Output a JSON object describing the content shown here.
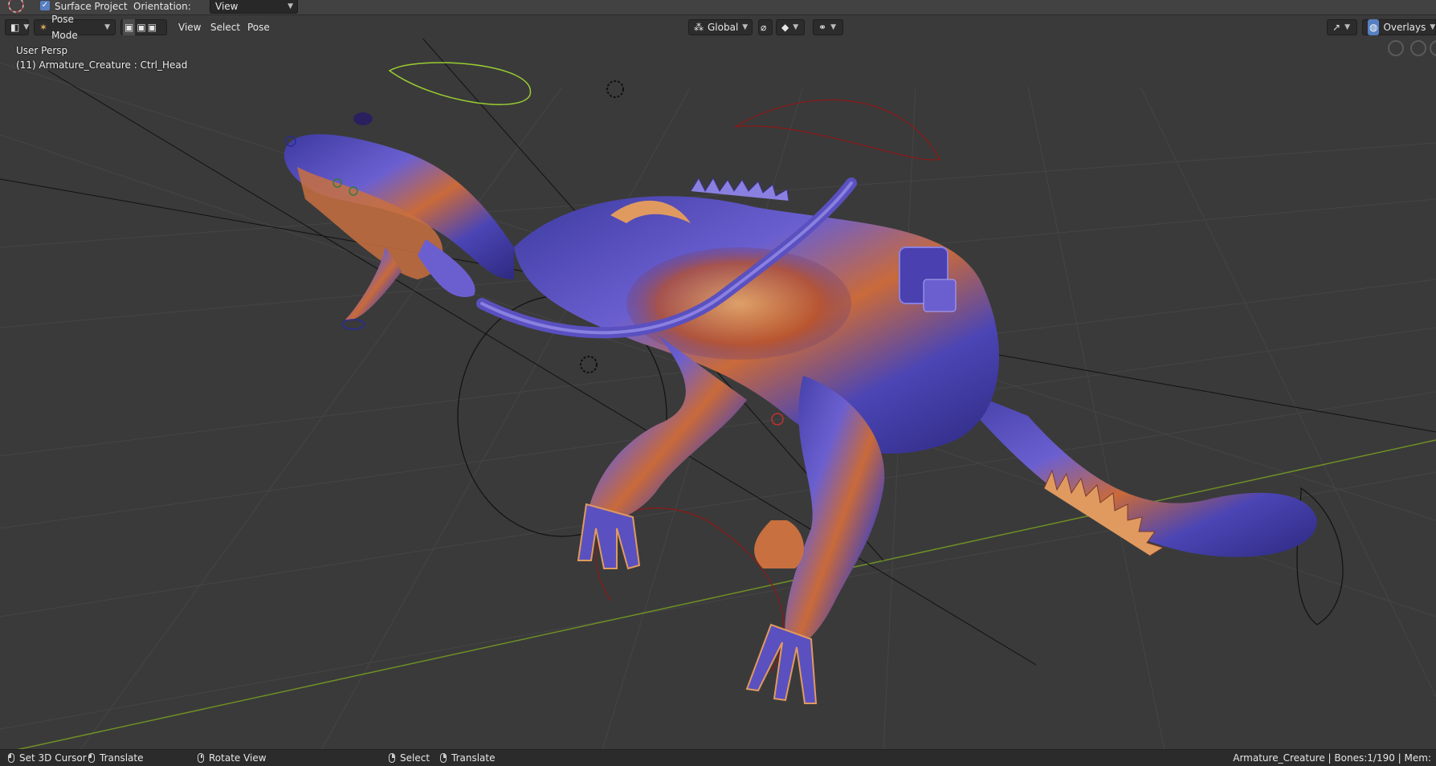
{
  "topbar": {
    "surface_project_label": "Surface Project",
    "orientation_label": "Orientation:",
    "orientation_value": "View"
  },
  "header": {
    "mode_label": "Pose Mode",
    "menus": [
      "View",
      "Select",
      "Pose"
    ],
    "transform_orientation": "Global",
    "overlays_label": "Overlays"
  },
  "viewport": {
    "view_name": "User Persp",
    "active_object": "(11) Armature_Creature : Ctrl_Head"
  },
  "statusbar": {
    "items": [
      "Set 3D Cursor",
      "Translate",
      "Rotate View",
      "Select",
      "Translate"
    ],
    "info": "Armature_Creature | Bones:1/190 | Mem:"
  },
  "colors": {
    "viewport_bg": "#3a3a3a",
    "accent": "#5680c2",
    "x_axis": "#8b2c2c",
    "y_axis": "#6f8f26"
  },
  "icons": [
    "cursor-tool-icon",
    "checkbox-icon",
    "editor-type-icon",
    "pose-mode-icon",
    "select-mode-icon",
    "global-axes-icon",
    "snap-icon",
    "proportional-icon",
    "viewport-shading-icon",
    "gizmo-icon",
    "overlays-icon",
    "navigation-gizmo-icon",
    "mouse-left-icon",
    "mouse-middle-icon",
    "mouse-right-icon"
  ]
}
